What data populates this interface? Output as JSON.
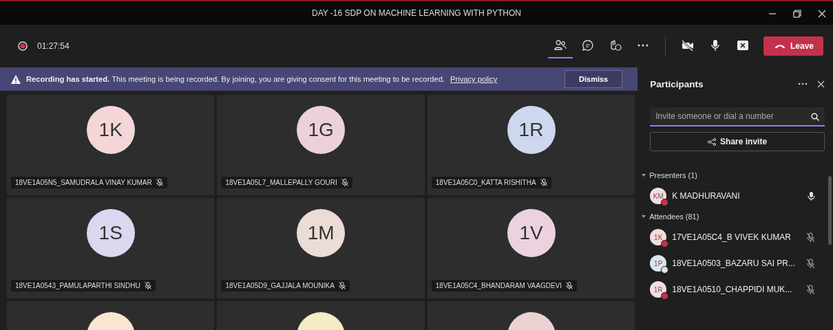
{
  "window": {
    "title": "DAY -16 SDP ON MACHINE LEARNING WITH PYTHON"
  },
  "toolbar": {
    "recording": true,
    "timer": "01:27:54",
    "participants_selected": true,
    "leave": "Leave"
  },
  "banner": {
    "text": "**Recording has started.** This meeting is being recorded. By joining, you are giving consent for this meeting to be recorded.",
    "link": "Privacy policy",
    "button": "Dismiss"
  },
  "tiles": [
    {
      "initials": "1K",
      "color": "#f4d6d8",
      "name": "18VE1A05N5_SAMUDRALA VINAY KUMAR",
      "muted": true
    },
    {
      "initials": "1G",
      "color": "#ecd2d8",
      "name": "18VE1A05L7_MALLEPALLY GOURI",
      "muted": true
    },
    {
      "initials": "1R",
      "color": "#cdd7ee",
      "name": "18VE1A05C0_KATTA RISHITHA",
      "muted": true
    },
    {
      "initials": "1S",
      "color": "#dcd6ee",
      "name": "18VE1A0543_PAMULAPARTHI SINDHU",
      "muted": true
    },
    {
      "initials": "1M",
      "color": "#ecdcd6",
      "name": "18VE1A05D9_GAJJALA MOUNIKA",
      "muted": true
    },
    {
      "initials": "1V",
      "color": "#ecd2e0",
      "name": "18VE1A05C4_BHANDARAM VAAGDEVI",
      "muted": true
    },
    {
      "color": "#f8e6d0"
    },
    {
      "color": "#f4ecc4"
    },
    {
      "color": "#ecd2d4"
    }
  ],
  "participants": {
    "title": "Participants",
    "search": {
      "placeholder": "Invite someone or dial a number"
    },
    "share": "Share invite",
    "groups": [
      {
        "label": "Presenters (1)",
        "expanded": true,
        "people": [
          {
            "initials": "KM",
            "name": "K MADHURAVANI",
            "color": "#c4314b",
            "muted": false
          }
        ]
      },
      {
        "label": "Attendees (81)",
        "expanded": true,
        "people": [
          {
            "initials": "1K",
            "name": "17VE1A05C4_B VIVEK KUMAR",
            "color": "#c4314b",
            "muted": true
          },
          {
            "initials": "1P",
            "name": "18VE1A0503_BAZARU SAI PR...",
            "color": "#e0e0e0",
            "muted": true
          },
          {
            "initials": "1R",
            "name": "18VE1A0510_CHAPPIDI MUK...",
            "color": "#c4314b",
            "muted": true
          }
        ]
      }
    ]
  }
}
